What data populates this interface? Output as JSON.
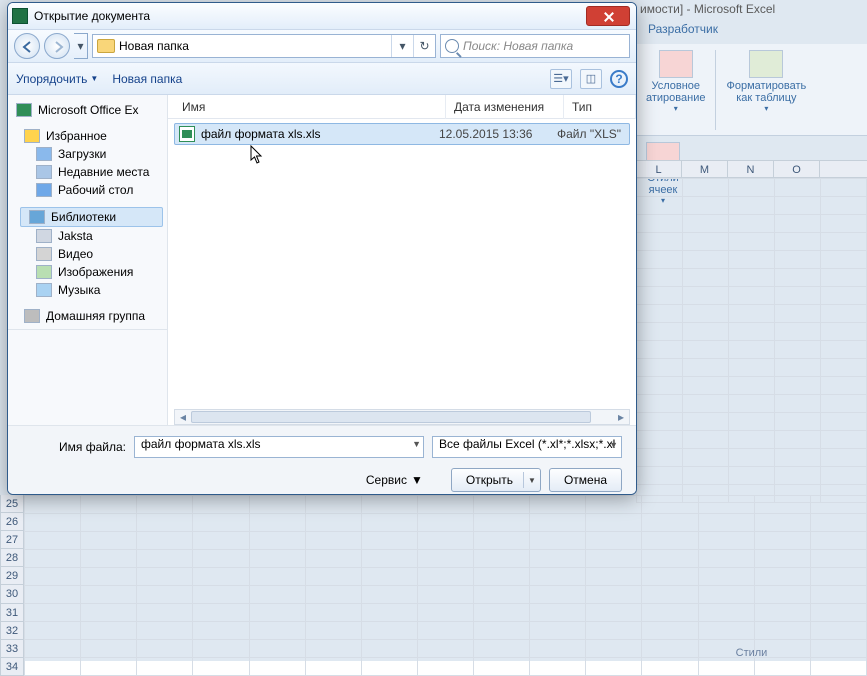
{
  "excel": {
    "title_suffix": "имости] - Microsoft Excel",
    "tab": "Разработчик",
    "ribbon": {
      "group_caption": "Стили",
      "cond_format": "Условное\nатирование",
      "format_table": "Форматировать\nкак таблицу",
      "cell_styles": "Стили\nячеек"
    },
    "cols": [
      "L",
      "M",
      "N",
      "O"
    ],
    "row_start": 25,
    "row_end": 34
  },
  "dialog": {
    "title": "Открытие документа",
    "breadcrumb": "Новая папка",
    "search_placeholder": "Поиск: Новая папка",
    "toolbar": {
      "organize": "Упорядочить",
      "new_folder": "Новая папка"
    },
    "sidebar": {
      "office": "Microsoft Office Ex",
      "favorites": "Избранное",
      "downloads": "Загрузки",
      "recent": "Недавние места",
      "desktop": "Рабочий стол",
      "libraries": "Библиотеки",
      "jaksta": "Jaksta",
      "video": "Видео",
      "pictures": "Изображения",
      "music": "Музыка",
      "homegroup": "Домашняя группа"
    },
    "columns": {
      "name": "Имя",
      "date": "Дата изменения",
      "type": "Тип"
    },
    "file": {
      "name": "файл формата xls.xls",
      "date": "12.05.2015 13:36",
      "type": "Файл \"XLS\""
    },
    "filename_label": "Имя файла:",
    "filename_value": "файл формата xls.xls",
    "filter": "Все файлы Excel (*.xl*;*.xlsx;*.xl",
    "tools": "Сервис",
    "open": "Открыть",
    "cancel": "Отмена"
  }
}
